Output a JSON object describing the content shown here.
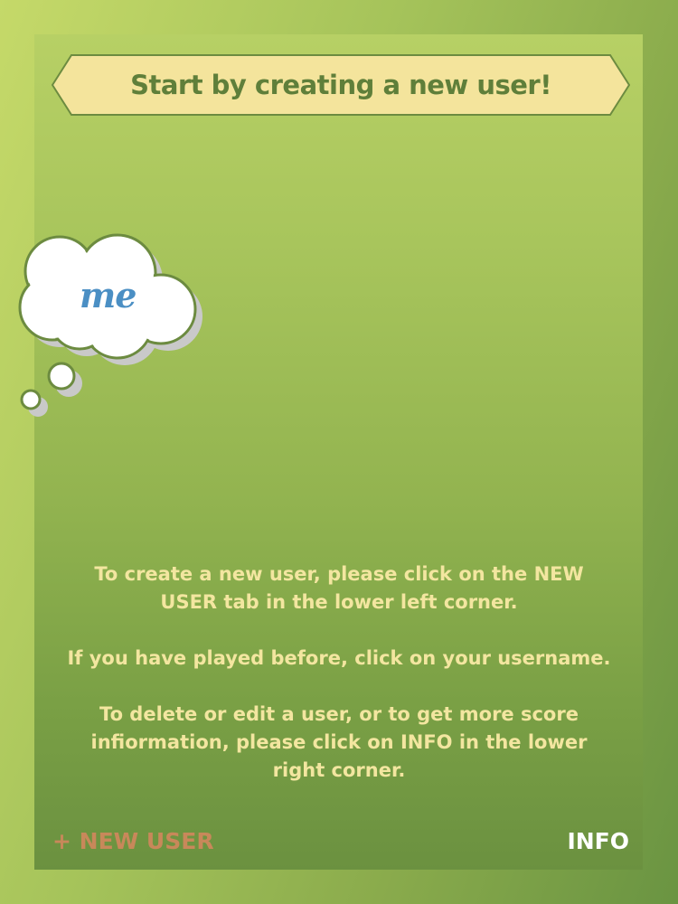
{
  "banner": {
    "title": "Start by creating a new user!"
  },
  "cloud": {
    "word": "me"
  },
  "instructions": {
    "line1": "To create a new user, please click on the NEW USER tab in the lower left corner.",
    "line2": "If you have played before, click on your username.",
    "line3": "To delete or edit a user, or to get more score infiormation, please click on INFO in the lower right corner."
  },
  "tabs": {
    "new_user": "+ NEW USER",
    "info": "INFO"
  },
  "colors": {
    "background": "#a5c35a",
    "banner_fill": "#f4e49c",
    "banner_text": "#5f7f3a",
    "instruction_text": "#f3e6a0",
    "new_user_text": "#c8885a",
    "info_text": "#ffffff",
    "cloud_word": "#4b8fc4"
  }
}
